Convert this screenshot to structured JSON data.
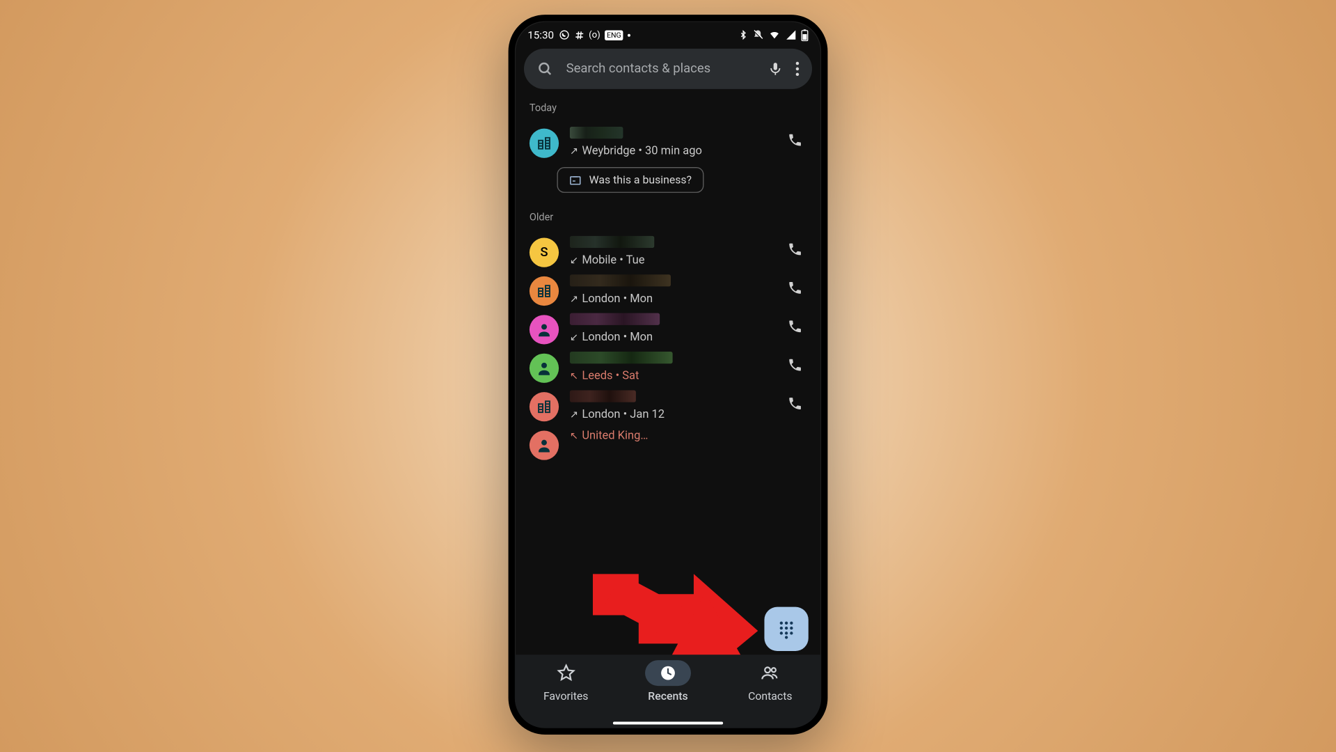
{
  "status": {
    "time": "15:30",
    "indicator_text": "(o)",
    "lang_badge": "ENG"
  },
  "search": {
    "placeholder": "Search contacts & places"
  },
  "sections": [
    {
      "label": "Today"
    },
    {
      "label": "Older"
    }
  ],
  "entries": [
    {
      "group": 0,
      "avatar_bg": "#3fb9cb",
      "avatar_kind": "business",
      "name_swatch": [
        "#3a4b3c",
        "#172018",
        "#1c2a1d",
        "#24352a"
      ],
      "name_w": 58,
      "direction": "↗",
      "sub_text": "Weybridge • 30 min ago",
      "missed": false,
      "chip_text": "Was this a business?"
    },
    {
      "group": 1,
      "avatar_bg": "#f5c641",
      "avatar_kind": "letter",
      "avatar_letter": "S",
      "name_swatch": [
        "#1d241c",
        "#26312a",
        "#11170f",
        "#2c3a2e"
      ],
      "name_w": 92,
      "direction": "↙",
      "sub_text": "Mobile • Tue",
      "missed": false
    },
    {
      "group": 1,
      "avatar_bg": "#e9873f",
      "avatar_kind": "business",
      "name_swatch": [
        "#262017",
        "#332a1d",
        "#1a150d",
        "#3e3321"
      ],
      "name_w": 110,
      "direction": "↗",
      "sub_text": "London • Mon",
      "missed": false
    },
    {
      "group": 1,
      "avatar_bg": "#e753bf",
      "avatar_kind": "person",
      "name_swatch": [
        "#3b1e33",
        "#4a2942",
        "#2a1524",
        "#52314b"
      ],
      "name_w": 98,
      "direction": "↙",
      "sub_text": "London • Mon",
      "missed": false
    },
    {
      "group": 1,
      "avatar_bg": "#63c256",
      "avatar_kind": "person",
      "name_swatch": [
        "#233a20",
        "#2c4a28",
        "#152812",
        "#36582f"
      ],
      "name_w": 112,
      "direction": "↖",
      "sub_text": "Leeds • Sat",
      "missed": true
    },
    {
      "group": 1,
      "avatar_bg": "#e37063",
      "avatar_kind": "business",
      "name_swatch": [
        "#2e1916",
        "#3e231f",
        "#1f100d",
        "#4a2b25"
      ],
      "name_w": 72,
      "direction": "↗",
      "sub_text": "London • Jan 12",
      "missed": false
    },
    {
      "group": 1,
      "avatar_bg": "#e37063",
      "avatar_kind": "person",
      "name_swatch": [],
      "name_w": 30,
      "no_name": true,
      "direction": "↖",
      "sub_text": "United King…",
      "missed": true,
      "no_phone": true
    }
  ],
  "nav": {
    "items": [
      {
        "key": "favorites",
        "label": "Favorites"
      },
      {
        "key": "recents",
        "label": "Recents"
      },
      {
        "key": "contacts",
        "label": "Contacts"
      }
    ],
    "active": "recents"
  }
}
